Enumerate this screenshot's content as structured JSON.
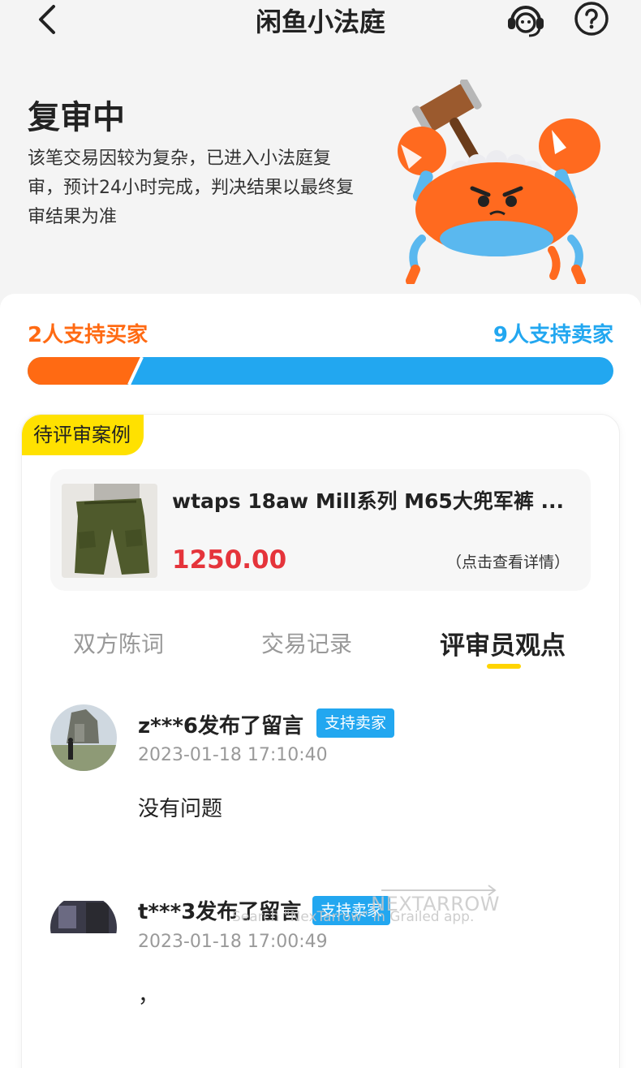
{
  "navbar": {
    "title": "闲鱼小法庭",
    "back_icon": "chevron-left-icon",
    "service_icon": "customer-service-icon",
    "help_icon": "question-circle-icon"
  },
  "status": {
    "title": "复审中",
    "description": "该笔交易因较为复杂，已进入小法庭复审，预计24小时完成，判决结果以最终复审结果为准"
  },
  "votes": {
    "buyer_label": "2人支持买家",
    "seller_label": "9人支持卖家",
    "buyer_count": 2,
    "seller_count": 9,
    "buyer_color": "#ff6a13",
    "seller_color": "#22a7f0"
  },
  "case": {
    "tag": "待评审案例",
    "product": {
      "title": "wtaps 18aw Mill系列 M65大兜军裤 ...",
      "price": "1250.00",
      "detail_link": "（点击查看详情）"
    }
  },
  "tabs": [
    {
      "label": "双方陈词",
      "active": false
    },
    {
      "label": "交易记录",
      "active": false
    },
    {
      "label": "评审员观点",
      "active": true
    }
  ],
  "comments": [
    {
      "user": "z***6发布了留言",
      "badge": "支持卖家",
      "time": "2023-01-18 17:10:40",
      "text": "没有问题"
    },
    {
      "user": "t***3发布了留言",
      "badge": "支持卖家",
      "time": "2023-01-18 17:00:49",
      "text": "，"
    }
  ],
  "watermark": {
    "brand": "NEXTARROW",
    "line": "Search \"NexTarrow\" in Grailed app."
  },
  "colors": {
    "accent_yellow": "#ffe100",
    "price_red": "#e5343b",
    "badge_blue": "#22a7f0"
  }
}
